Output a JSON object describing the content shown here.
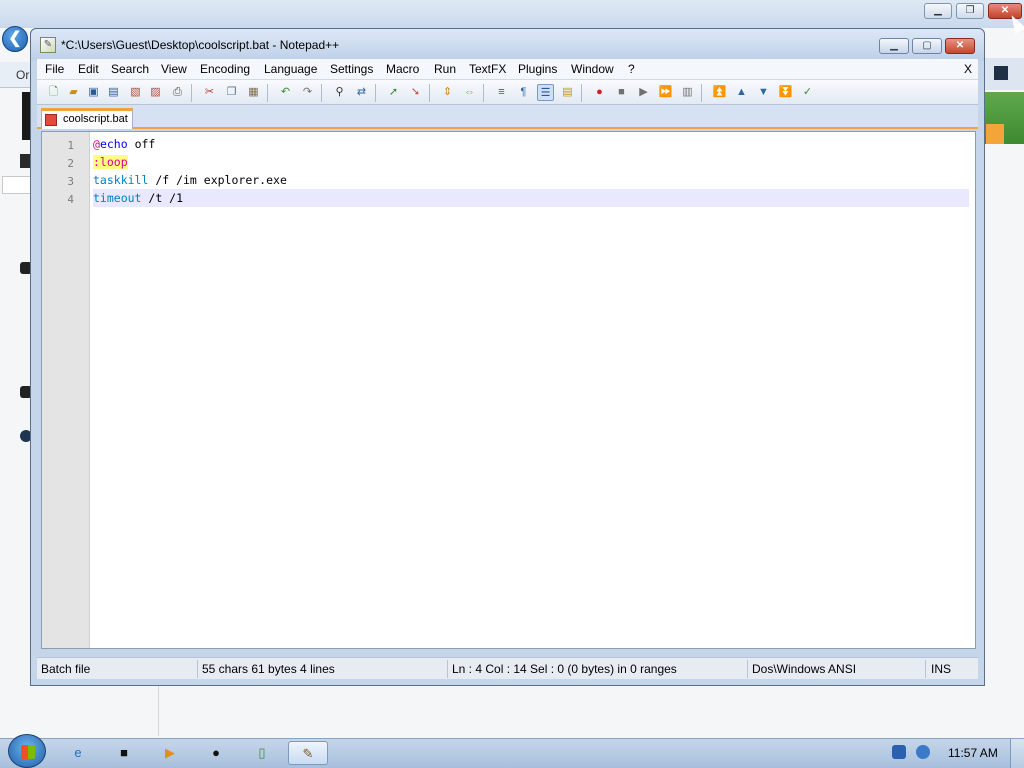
{
  "window": {
    "title": "*C:\\Users\\Guest\\Desktop\\coolscript.bat - Notepad++"
  },
  "menu": {
    "items": [
      "File",
      "Edit",
      "Search",
      "View",
      "Encoding",
      "Language",
      "Settings",
      "Macro",
      "Run",
      "TextFX",
      "Plugins",
      "Window",
      "?"
    ],
    "close_label": "X"
  },
  "toolbar": {
    "icons": [
      "new-file-icon",
      "open-file-icon",
      "save-icon",
      "save-all-icon",
      "close-icon",
      "close-all-icon",
      "print-icon",
      "cut-icon",
      "copy-icon",
      "paste-icon",
      "undo-icon",
      "redo-icon",
      "find-icon",
      "replace-icon",
      "zoom-in-icon",
      "zoom-out-icon",
      "sync-vertical-icon",
      "sync-horizontal-icon",
      "word-wrap-icon",
      "show-all-chars-icon",
      "indent-guide-icon",
      "doc-map-icon",
      "record-macro-icon",
      "stop-macro-icon",
      "play-macro-icon",
      "run-macro-multiple-icon",
      "save-macro-icon",
      "fold-all-icon",
      "collapse-icon",
      "expand-icon",
      "unfold-all-icon",
      "spell-check-icon"
    ]
  },
  "tab": {
    "label": "coolscript.bat",
    "accent": "#f2a340"
  },
  "editor": {
    "line_numbers": [
      "1",
      "2",
      "3",
      "4"
    ],
    "lines": [
      {
        "at": "@",
        "cmd": "echo",
        "rest": " off"
      },
      {
        "label": ":loop"
      },
      {
        "kw": "taskkill",
        "rest": " /f /im explorer.exe"
      },
      {
        "kw": "timeout",
        "rest": " /t /1"
      }
    ],
    "current_line": 4
  },
  "status": {
    "lang": "Batch file",
    "counts": "55 chars   61 bytes   4 lines",
    "position": "Ln : 4    Col : 14    Sel : 0 (0 bytes) in 0 ranges",
    "encoding": "Dos\\Windows  ANSI",
    "mode": "INS"
  },
  "taskbar": {
    "clock": "11:57 AM"
  },
  "background": {
    "strip_text": "Or"
  }
}
